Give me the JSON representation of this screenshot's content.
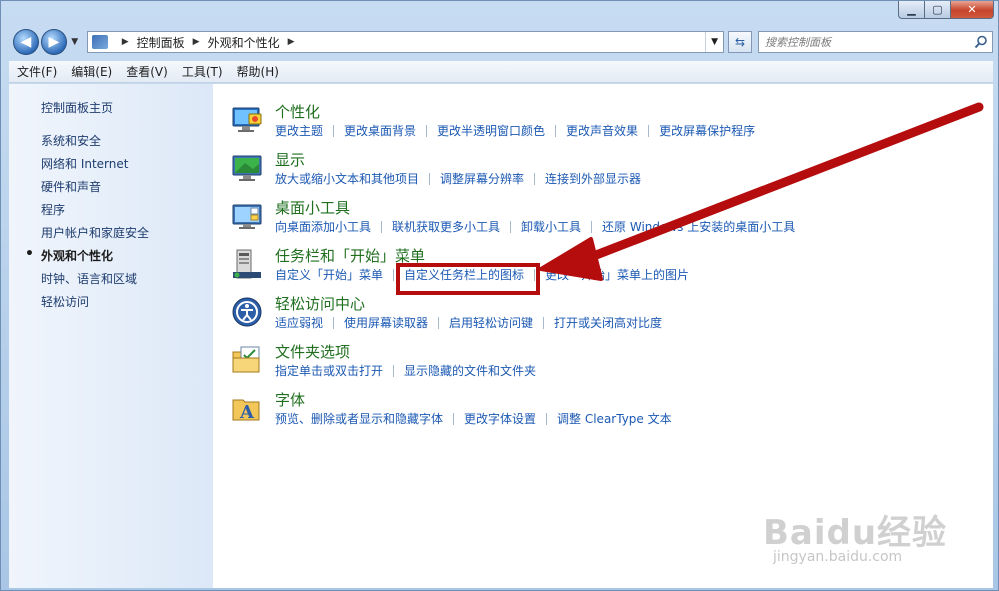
{
  "address": {
    "breadcrumbs": [
      "控制面板",
      "外观和个性化"
    ],
    "search_placeholder": "搜索控制面板"
  },
  "menu": [
    "文件(F)",
    "编辑(E)",
    "查看(V)",
    "工具(T)",
    "帮助(H)"
  ],
  "sidebar": {
    "home": "控制面板主页",
    "items": [
      {
        "label": "系统和安全",
        "active": false
      },
      {
        "label": "网络和 Internet",
        "active": false
      },
      {
        "label": "硬件和声音",
        "active": false
      },
      {
        "label": "程序",
        "active": false
      },
      {
        "label": "用户帐户和家庭安全",
        "active": false
      },
      {
        "label": "外观和个性化",
        "active": true
      },
      {
        "label": "时钟、语言和区域",
        "active": false
      },
      {
        "label": "轻松访问",
        "active": false
      }
    ]
  },
  "categories": [
    {
      "title": "个性化",
      "icon": "personalization-icon",
      "links": [
        "更改主题",
        "更改桌面背景",
        "更改半透明窗口颜色",
        "更改声音效果",
        "更改屏幕保护程序"
      ]
    },
    {
      "title": "显示",
      "icon": "display-icon",
      "links": [
        "放大或缩小文本和其他项目",
        "调整屏幕分辨率",
        "连接到外部显示器"
      ]
    },
    {
      "title": "桌面小工具",
      "icon": "gadgets-icon",
      "links": [
        "向桌面添加小工具",
        "联机获取更多小工具",
        "卸载小工具",
        "还原 Windows 上安装的桌面小工具"
      ]
    },
    {
      "title": "任务栏和「开始」菜单",
      "icon": "taskbar-icon",
      "links": [
        "自定义「开始」菜单",
        "自定义任务栏上的图标",
        "更改「开始」菜单上的图片"
      ]
    },
    {
      "title": "轻松访问中心",
      "icon": "ease-of-access-icon",
      "links": [
        "适应弱视",
        "使用屏幕读取器",
        "启用轻松访问键",
        "打开或关闭高对比度"
      ]
    },
    {
      "title": "文件夹选项",
      "icon": "folder-options-icon",
      "links": [
        "指定单击或双击打开",
        "显示隐藏的文件和文件夹"
      ]
    },
    {
      "title": "字体",
      "icon": "fonts-icon",
      "links": [
        "预览、删除或者显示和隐藏字体",
        "更改字体设置",
        "调整 ClearType 文本"
      ]
    }
  ],
  "watermark": {
    "logo": "Baidu经验",
    "url": "jingyan.baidu.com"
  },
  "colors": {
    "link": "#1c59b3",
    "title": "#1f6f1f",
    "annotation": "#b50d0d"
  }
}
